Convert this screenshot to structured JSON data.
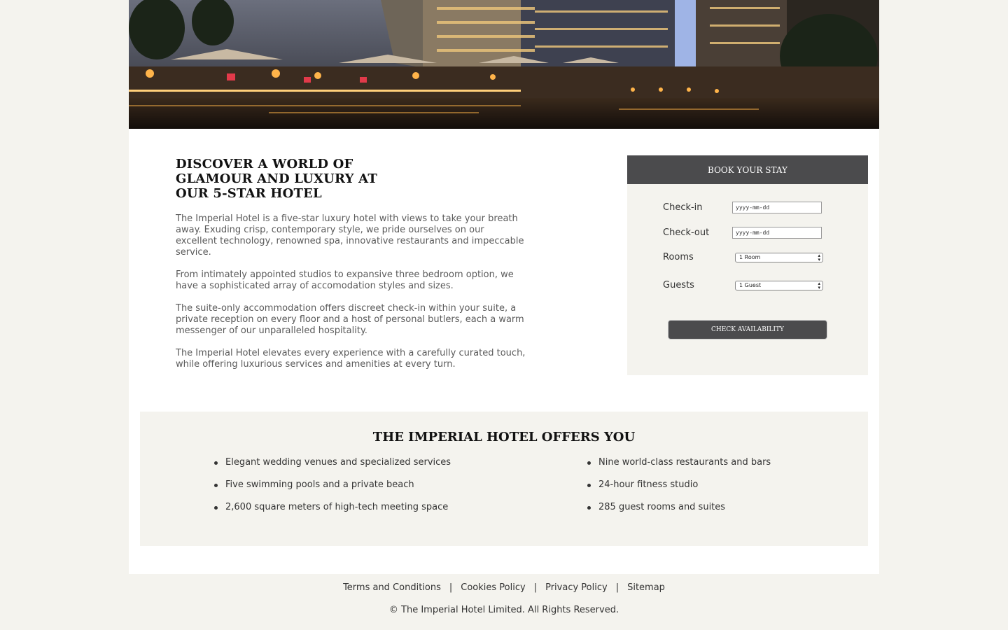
{
  "intro": {
    "heading": "DISCOVER A WORLD OF GLAMOUR AND LUXURY AT OUR 5-STAR HOTEL",
    "paragraphs": [
      "The Imperial Hotel is a five-star luxury hotel with views to take your breath away. Exuding crisp, contemporary style, we pride ourselves on our excellent technology, renowned spa, innovative restaurants and impeccable service.",
      "From intimately appointed studios to expansive three bedroom option, we have a sophisticated array of accomodation styles and sizes.",
      "The suite-only accommodation offers discreet check-in within your suite, a private reception on every floor and a host of personal butlers, each a warm messenger of our unparalleled hospitality.",
      "The Imperial Hotel elevates every experience with a carefully curated touch, while offering luxurious services and amenities at every turn."
    ]
  },
  "booking": {
    "title": "BOOK YOUR STAY",
    "checkin_label": "Check-in",
    "checkin_placeholder": "yyyy-mm-dd",
    "checkout_label": "Check-out",
    "checkout_placeholder": "yyyy-mm-dd",
    "rooms_label": "Rooms",
    "rooms_value": "1 Room",
    "guests_label": "Guests",
    "guests_value": "1 Guest",
    "button_label": "CHECK AVAILABILITY"
  },
  "offers": {
    "title": "THE IMPERIAL HOTEL OFFERS YOU",
    "left": [
      "Elegant wedding venues and specialized services",
      "Five swimming pools and a private beach",
      "2,600 square meters of high-tech meeting space"
    ],
    "right": [
      "Nine world-class restaurants and bars",
      "24-hour fitness studio",
      "285 guest rooms and suites"
    ]
  },
  "footer": {
    "links": [
      "Terms and Conditions",
      "Cookies Policy",
      "Privacy Policy",
      "Sitemap"
    ],
    "separator": "|",
    "copyright": "© The Imperial Hotel Limited. All Rights Reserved."
  },
  "colors": {
    "page_bg": "#f4f3ee",
    "header_dark": "#4b4b4d",
    "content_bg": "#ffffff"
  }
}
